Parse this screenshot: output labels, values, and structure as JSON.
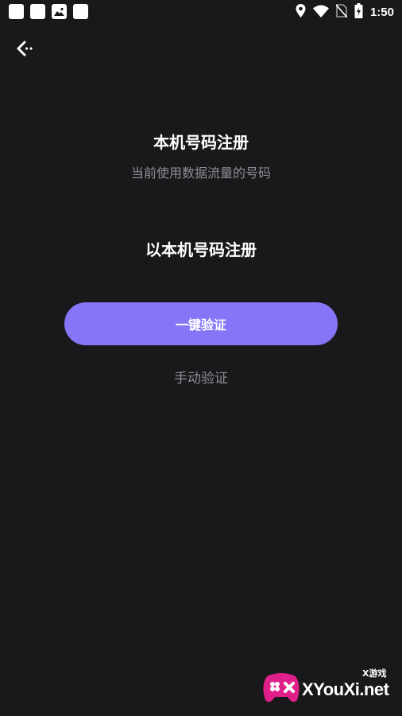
{
  "status_bar": {
    "time": "1:50",
    "left_icons": [
      "app-square-icon",
      "app-square-icon",
      "image-icon",
      "app-square-icon"
    ],
    "right_icons": [
      "location-icon",
      "wifi-icon",
      "no-sim-icon",
      "battery-charging-icon"
    ]
  },
  "header": {
    "back_icon": "back-arrow-icon"
  },
  "main": {
    "title": "本机号码注册",
    "subtitle": "当前使用数据流量的号码",
    "phone_label": "以本机号码注册",
    "primary_button": "一键验证",
    "manual_link": "手动验证"
  },
  "watermark": {
    "text": "XYouXi.net",
    "tag": "X游戏"
  },
  "colors": {
    "background": "#19181a",
    "accent": "#8476f7",
    "muted_text": "#8e8d93",
    "text": "#ffffff"
  }
}
